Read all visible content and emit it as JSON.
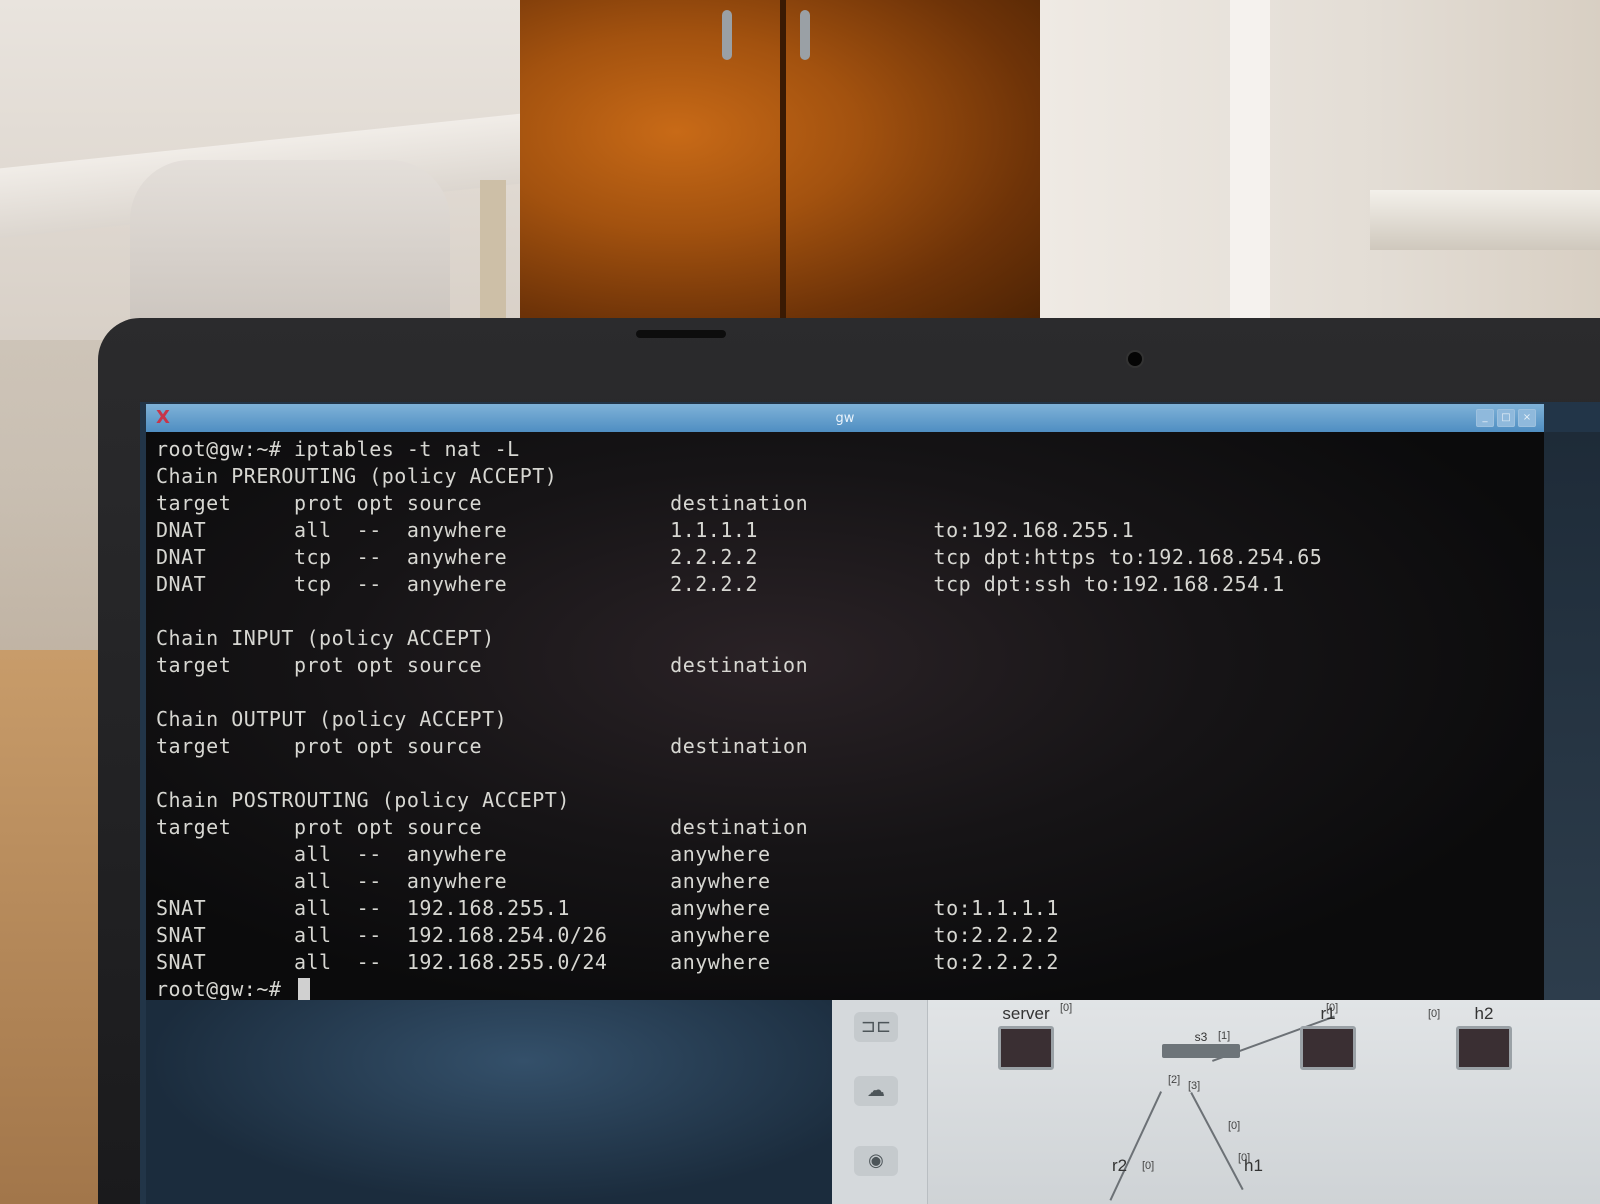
{
  "window": {
    "title": "gw"
  },
  "terminal": {
    "lines": [
      "root@gw:~# iptables -t nat -L",
      "Chain PREROUTING (policy ACCEPT)",
      "target     prot opt source               destination",
      "DNAT       all  --  anywhere             1.1.1.1              to:192.168.255.1",
      "DNAT       tcp  --  anywhere             2.2.2.2              tcp dpt:https to:192.168.254.65",
      "DNAT       tcp  --  anywhere             2.2.2.2              tcp dpt:ssh to:192.168.254.1",
      "",
      "Chain INPUT (policy ACCEPT)",
      "target     prot opt source               destination",
      "",
      "Chain OUTPUT (policy ACCEPT)",
      "target     prot opt source               destination",
      "",
      "Chain POSTROUTING (policy ACCEPT)",
      "target     prot opt source               destination",
      "           all  --  anywhere             anywhere",
      "           all  --  anywhere             anywhere",
      "SNAT       all  --  192.168.255.1        anywhere             to:1.1.1.1",
      "SNAT       all  --  192.168.254.0/26     anywhere             to:2.2.2.2",
      "SNAT       all  --  192.168.255.0/24     anywhere             to:2.2.2.2"
    ],
    "prompt": "root@gw:~# "
  },
  "topology": {
    "nodes": {
      "server": "server",
      "s3": "s3",
      "r1": "r1",
      "h2": "h2",
      "r2": "r2",
      "h1": "h1"
    },
    "ports": [
      "[0]",
      "[1]",
      "[0]",
      "[0]",
      "[2]",
      "[3]",
      "[0]",
      "[0]",
      "[0]"
    ]
  },
  "colors": {
    "titlebar": "#4f8ec2",
    "terminal_text": "#d7d7d2",
    "terminal_bg": "#111012"
  },
  "icons": {
    "window_icon": "x-logo-icon",
    "minimize": "minimize-icon",
    "maximize": "maximize-icon",
    "close": "close-icon"
  }
}
